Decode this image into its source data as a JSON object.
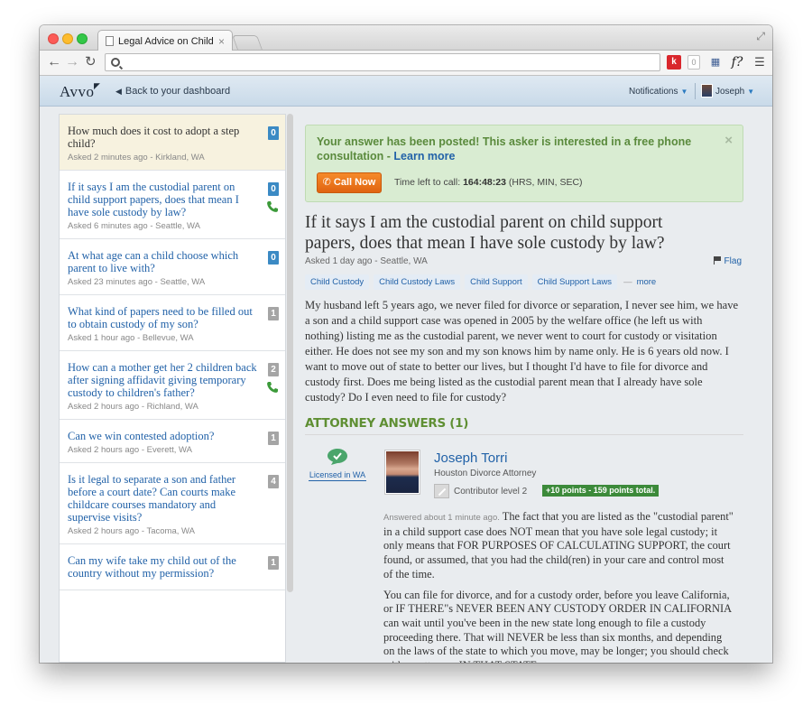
{
  "browser": {
    "tab_title": "Legal Advice on Child Cust",
    "tab_close": "×",
    "url": "",
    "ext_k": "k",
    "ext_count": "0",
    "ext_fq": "f?",
    "back": "←",
    "forward": "→",
    "reload": "↻",
    "fullscreen": "⤢"
  },
  "header": {
    "logo": "Avvo",
    "back_link": "Back to your dashboard",
    "notifications": "Notifications",
    "user": "Joseph"
  },
  "questions": [
    {
      "title": "How much does it cost to adopt a step child?",
      "meta": "Asked 2 minutes ago - Kirkland, WA",
      "count": "0",
      "badge": "blue",
      "phone": false,
      "active": true
    },
    {
      "title": "If it says I am the custodial parent on child support papers, does that mean I have sole custody by law?",
      "meta": "Asked 6 minutes ago - Seattle, WA",
      "count": "0",
      "badge": "blue",
      "phone": true,
      "active": false
    },
    {
      "title": "At what age can a child choose which parent to live with?",
      "meta": "Asked 23 minutes ago - Seattle, WA",
      "count": "0",
      "badge": "blue",
      "phone": false,
      "active": false
    },
    {
      "title": "What kind of papers need to be filled out to obtain custody of my son?",
      "meta": "Asked 1 hour ago - Bellevue, WA",
      "count": "1",
      "badge": "grey",
      "phone": false,
      "active": false
    },
    {
      "title": "How can a mother get her 2 children back after signing affidavit giving temporary custody to children's father?",
      "meta": "Asked 2 hours ago - Richland, WA",
      "count": "2",
      "badge": "grey",
      "phone": true,
      "active": false
    },
    {
      "title": "Can we win contested adoption?",
      "meta": "Asked 2 hours ago - Everett, WA",
      "count": "1",
      "badge": "grey",
      "phone": false,
      "active": false
    },
    {
      "title": "Is it legal to separate a son and father before a court date? Can courts make childcare courses mandatory and supervise visits?",
      "meta": "Asked 2 hours ago - Tacoma, WA",
      "count": "4",
      "badge": "grey",
      "phone": false,
      "active": false
    },
    {
      "title": "Can my wife take my child out of the country without my permission?",
      "meta": "",
      "count": "1",
      "badge": "grey",
      "phone": false,
      "active": false
    }
  ],
  "alert": {
    "message": "Your answer has been posted! This asker is interested in a free phone consultation - ",
    "link": "Learn more",
    "close": "×",
    "call_button": "Call Now",
    "timer_label": "Time left to call:",
    "timer_value": "164:48:23",
    "timer_units": "(HRS, MIN, SEC)"
  },
  "question": {
    "title": "If it says I am the custodial parent on child support papers, does that mean I have sole custody by law?",
    "meta": "Asked 1 day ago - Seattle, WA",
    "flag": "Flag",
    "tags": [
      "Child Custody",
      "Child Custody Laws",
      "Child Support",
      "Child Support Laws"
    ],
    "tags_more": "more",
    "body": "My husband left 5 years ago, we never filed for divorce or separation, I never see him, we have a son and a child support case was opened in 2005 by the welfare office (he left us with nothing) listing me as the custodial parent, we never went to court for custody or visitation either. He does not see my son and my son knows him by name only. He is 6 years old now. I want to move out of state to better our lives, but I thought I'd have to file for divorce and custody first. Does me being listed as the custodial parent mean that I already have sole custody? Do I even need to file for custody?"
  },
  "answers": {
    "heading": "ATTORNEY ANSWERS (1)",
    "licensed": "Licensed in WA",
    "attorney_name": "Joseph Torri",
    "attorney_role": "Houston Divorce Attorney",
    "contributor_level": "Contributor level  2",
    "points": "+10 points - 159 points total.",
    "answered_meta": "Answered about 1 minute ago.",
    "paragraph_1": "The fact that you are listed as the \"custodial parent\" in a child support case does NOT mean that you have sole legal custody; it only means that FOR PURPOSES OF CALCULATING SUPPORT, the court found, or assumed, that you had the child(ren) in your care and control most of the time.",
    "paragraph_2": "You can file for divorce, and for a custody order, before you leave California, or IF THERE\"s NEVER BEEN ANY CUSTODY ORDER IN CALIFORNIA can wait until you've been in the new state long enough to file a custody proceeding there. That will NEVER be less than six months, and depending on the laws of the state to which you move, may be longer; you should check with an attorney IN THAT STATE."
  },
  "colors": {
    "link": "#2262a8",
    "alert_bg": "#d9ecd2",
    "alert_text": "#5a8a3c",
    "call_button": "#f07a1e",
    "answers_heading": "#5f8f33",
    "badge_blue": "#3b8ac4",
    "badge_grey": "#a5a5a5",
    "points_badge": "#3c8a3a"
  }
}
